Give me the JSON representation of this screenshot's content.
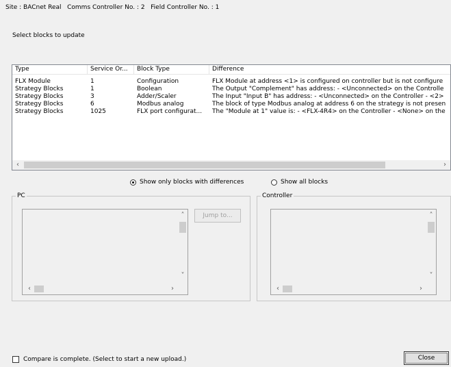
{
  "header": {
    "site_label": "Site : BACnet Real",
    "comms_label": "Comms Controller No. : 2",
    "field_label": "Field Controller No. : 1"
  },
  "select_label": "Select blocks to update",
  "table": {
    "columns": [
      "Type",
      "Service Or...",
      "Block Type",
      "Difference"
    ],
    "rows": [
      [
        "FLX Module",
        "1",
        "Configuration",
        "FLX Module at address <1> is configured on controller but is not configure"
      ],
      [
        "Strategy Blocks",
        "1",
        "Boolean",
        "The Output \"Complement\" has address: - <Unconnected> on the Controlle"
      ],
      [
        "Strategy Blocks",
        "3",
        "Adder/Scaler",
        "The Input \"Input B\" has address: - <Unconnected> on the Controller - <2>"
      ],
      [
        "Strategy Blocks",
        "6",
        "Modbus analog",
        "The block of type Modbus analog at address 6 on the strategy is not presen"
      ],
      [
        "Strategy Blocks",
        "1025",
        "FLX port configurat...",
        "The \"Module at 1\" value is: - <FLX-4R4> on the Controller - <None> on the"
      ]
    ]
  },
  "filter": {
    "show_differences_label": "Show only blocks with differences",
    "show_all_label": "Show all blocks",
    "selected": "differences"
  },
  "pc_group": {
    "title": "PC"
  },
  "controller_group": {
    "title": "Controller"
  },
  "jump_button": {
    "label": "Jump to..."
  },
  "compare": {
    "label": "Compare is complete.  (Select to start a new upload.)",
    "checked": false
  },
  "close_button": {
    "label": "Close"
  }
}
